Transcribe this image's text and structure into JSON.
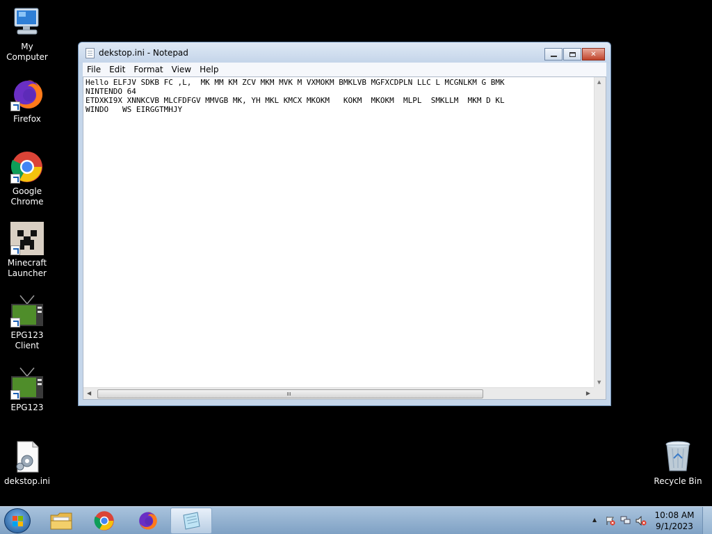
{
  "desktop": {
    "icons": [
      {
        "label": "My Computer",
        "icon": "computer-icon"
      },
      {
        "label": "Firefox",
        "icon": "firefox-icon"
      },
      {
        "label": "Google Chrome",
        "icon": "chrome-icon"
      },
      {
        "label": "Minecraft Launcher",
        "icon": "minecraft-icon"
      },
      {
        "label": "EPG123 Client",
        "icon": "tv-icon"
      },
      {
        "label": "EPG123",
        "icon": "tv-icon"
      },
      {
        "label": "dekstop.ini",
        "icon": "settings-file-icon"
      },
      {
        "label": "Recycle Bin",
        "icon": "recycle-bin-icon"
      }
    ]
  },
  "notepad": {
    "title": "dekstop.ini - Notepad",
    "menu": [
      "File",
      "Edit",
      "Format",
      "View",
      "Help"
    ],
    "content": "Hello ELFJV SDKB FC ,L,  MK MM KM ZCV MKM MVK M VXMOKM BMKLVB MGFXCDPLN LLC L MCGNLKM G BMK\nNINTENDO 64\nETDXKI9X XNNKCVB MLCFDFGV MMVGB MK, YH MKL KMCX MKOKM   KOKM  MKOKM  MLPL  SMKLLM  MKM D KL\nWINDO   WS EIRGGTMHJY",
    "window_buttons": {
      "minimize": "minimize",
      "restore": "restore",
      "close": "close"
    }
  },
  "taskbar": {
    "items": [
      {
        "name": "explorer",
        "icon": "folder-icon"
      },
      {
        "name": "chrome",
        "icon": "chrome-icon"
      },
      {
        "name": "firefox",
        "icon": "firefox-icon"
      },
      {
        "name": "notepad",
        "icon": "notepad-icon",
        "active": true
      }
    ],
    "clock_time": "10:08 AM",
    "clock_date": "9/1/2023"
  },
  "colors": {
    "desktop_bg": "#000000",
    "taskbar": "#8eb0d2",
    "close_button": "#c0432a"
  }
}
